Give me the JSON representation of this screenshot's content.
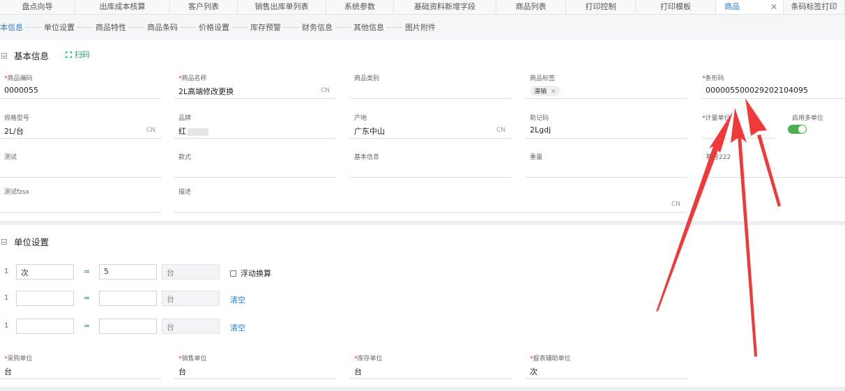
{
  "tabs": [
    {
      "label": "盘点向导"
    },
    {
      "label": "出库成本核算"
    },
    {
      "label": "客户列表"
    },
    {
      "label": "销售出库单列表"
    },
    {
      "label": "系统参数"
    },
    {
      "label": "基础资料新增字段"
    },
    {
      "label": "商品列表"
    },
    {
      "label": "打印控制"
    },
    {
      "label": "打印模板"
    },
    {
      "label": "商品",
      "active": true
    },
    {
      "label": "条码标签打印"
    }
  ],
  "anchors": [
    "本信息",
    "单位设置",
    "商品特性",
    "商品条码",
    "价格设置",
    "库存预警",
    "财务信息",
    "其他信息",
    "图片附件"
  ],
  "basic": {
    "title": "基本信息",
    "scan": "扫码",
    "code": {
      "label": "商品编码",
      "value": "0000055"
    },
    "name": {
      "label": "商品名称",
      "value": "2L高端修改更换",
      "cn": "CN"
    },
    "category": {
      "label": "商品类别",
      "value": ""
    },
    "tag": {
      "label": "商品标签",
      "value": "滞销"
    },
    "barcode": {
      "label": "条形码",
      "value": "00000550002920210409​5"
    },
    "spec": {
      "label": "规格型号",
      "value": "2L/台",
      "cn": "CN"
    },
    "brand": {
      "label": "品牌",
      "value": "红"
    },
    "origin": {
      "label": "产地",
      "value": "广东中山",
      "cn": "CN"
    },
    "mnemonic": {
      "label": "助记码",
      "value": "2Lgdj"
    },
    "unit": {
      "label": "计量单位",
      "value": ""
    },
    "multi_unit": {
      "label": "启用多单位",
      "on": true
    },
    "test": {
      "label": "测试",
      "value": ""
    },
    "style": {
      "label": "款式",
      "value": ""
    },
    "basic_info": {
      "label": "基本信息",
      "value": ""
    },
    "weight": {
      "label": "重量",
      "value": ""
    },
    "box_no": {
      "label": "箱号222",
      "value": ""
    },
    "test_fzsx": {
      "label": "测试fzsx",
      "value": ""
    },
    "desc": {
      "label": "描述",
      "value": "",
      "cn": "CN"
    }
  },
  "units": {
    "title": "单位设置",
    "rows": [
      {
        "index": "1",
        "qty_unit": "次",
        "factor": "5",
        "base": "台",
        "extra": "浮动换算"
      },
      {
        "index": "1",
        "qty_unit": "",
        "factor": "",
        "base": "台",
        "extra": "清空"
      },
      {
        "index": "1",
        "qty_unit": "",
        "factor": "",
        "base": "台",
        "extra": "清空"
      }
    ],
    "purchase": {
      "label": "采购单位",
      "value": "台"
    },
    "sales": {
      "label": "销售单位",
      "value": "台"
    },
    "stock": {
      "label": "库存单位",
      "value": "台"
    },
    "report": {
      "label": "报表辅助单位",
      "value": "次"
    }
  },
  "colors": {
    "accent": "#2b7cd3",
    "required": "#e53935",
    "toggle": "#4caf50",
    "scan": "#1aaa6a",
    "annotation_arrow": "#f03a3a"
  }
}
